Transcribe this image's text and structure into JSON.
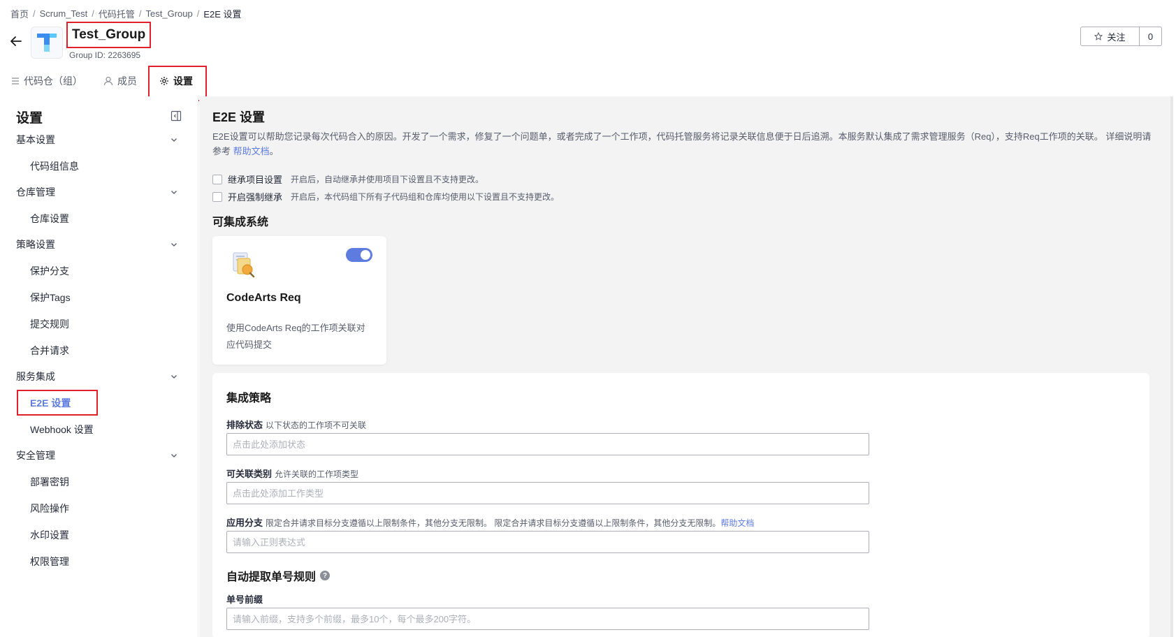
{
  "breadcrumb": [
    "首页",
    "Scrum_Test",
    "代码托管",
    "Test_Group",
    "E2E 设置"
  ],
  "header": {
    "group_name": "Test_Group",
    "group_id": "Group ID: 2263695",
    "follow_label": "关注",
    "follow_count": "0"
  },
  "tabs": [
    {
      "label": "代码仓（组）",
      "icon": "list-icon"
    },
    {
      "label": "成员",
      "icon": "user-icon"
    },
    {
      "label": "设置",
      "icon": "gear-icon"
    }
  ],
  "sidebar": {
    "title": "设置",
    "groups": [
      {
        "label": "基本设置",
        "items": [
          "代码组信息"
        ]
      },
      {
        "label": "仓库管理",
        "items": [
          "仓库设置"
        ]
      },
      {
        "label": "策略设置",
        "items": [
          "保护分支",
          "保护Tags",
          "提交规则",
          "合并请求"
        ]
      },
      {
        "label": "服务集成",
        "items": [
          "E2E 设置",
          "Webhook 设置"
        ]
      },
      {
        "label": "安全管理",
        "items": [
          "部署密钥",
          "风险操作",
          "水印设置",
          "权限管理"
        ]
      }
    ]
  },
  "main": {
    "title": "E2E 设置",
    "desc": "E2E设置可以帮助您记录每次代码合入的原因。开发了一个需求，修复了一个问题单，或者完成了一个工作项，代码托管服务将记录关联信息便于日后追溯。本服务默认集成了需求管理服务（Req），支持Req工作项的关联。 详细说明请参考",
    "desc_link": "帮助文档",
    "desc_end": "。",
    "inherit": {
      "label": "继承项目设置",
      "hint": "开启后，自动继承并使用项目下设置且不支持更改。"
    },
    "force_inherit": {
      "label": "开启强制继承",
      "hint": "开启后，本代码组下所有子代码组和仓库均使用以下设置且不支持更改。"
    },
    "systems_title": "可集成系统",
    "card": {
      "title": "CodeArts Req",
      "desc": "使用CodeArts Req的工作项关联对应代码提交",
      "enabled": true
    },
    "strategy": {
      "title": "集成策略",
      "exclude_label": "排除状态",
      "exclude_hint": "以下状态的工作项不可关联",
      "exclude_placeholder": "点击此处添加状态",
      "types_label": "可关联类别",
      "types_hint": "允许关联的工作项类型",
      "types_placeholder": "点击此处添加工作类型",
      "branch_label": "应用分支",
      "branch_hint": "限定合并请求目标分支遵循以上限制条件，其他分支无限制。 限定合并请求目标分支遵循以上限制条件，其他分支无限制。",
      "branch_link": "帮助文档",
      "branch_placeholder": "请输入正则表达式",
      "auto_title": "自动提取单号规则",
      "prefix_label": "单号前缀",
      "prefix_placeholder": "请输入前缀，支持多个前缀，最多10个，每个最多200字符。"
    }
  },
  "colors": {
    "accent": "#5e7ce0",
    "highlight": "#e0202a"
  }
}
